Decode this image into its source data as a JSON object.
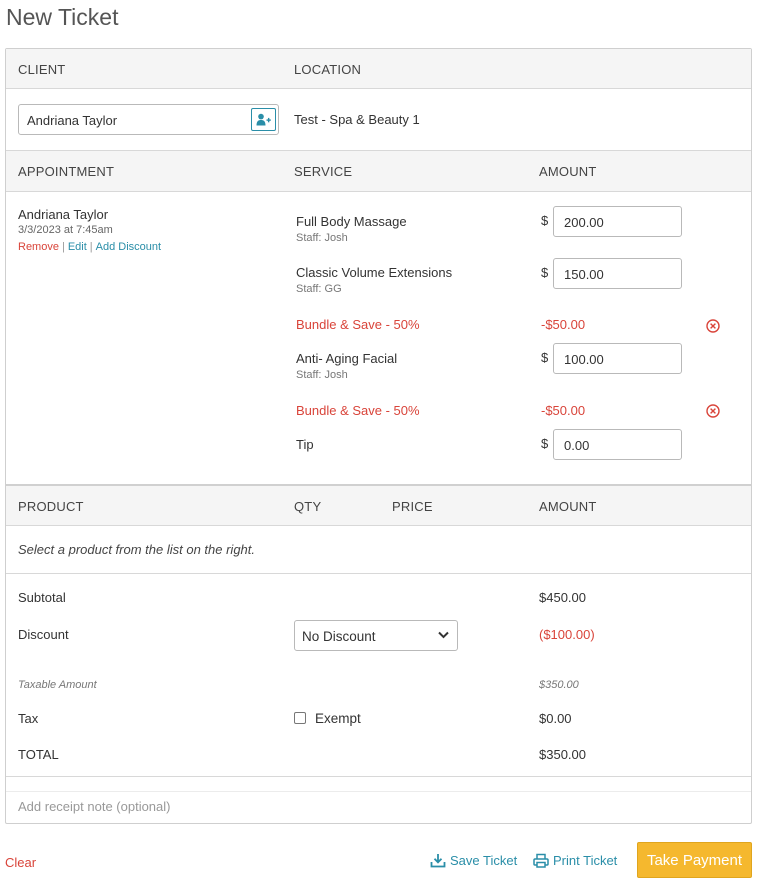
{
  "page": {
    "title": "New Ticket"
  },
  "client_section": {
    "client_header": "CLIENT",
    "location_header": "LOCATION",
    "client_value": "Andriana Taylor",
    "location_value": "Test - Spa & Beauty 1"
  },
  "appointment_section": {
    "appointment_header": "APPOINTMENT",
    "service_header": "SERVICE",
    "amount_header": "AMOUNT",
    "client_name": "Andriana Taylor",
    "datetime": "3/3/2023 at 7:45am",
    "actions": {
      "remove": "Remove",
      "edit": "Edit",
      "add_discount": "Add Discount",
      "separator": "|"
    },
    "currency": "$",
    "services": [
      {
        "name": "Full Body Massage",
        "staff": "Staff: Josh",
        "amount": "200.00"
      },
      {
        "name": "Classic Volume Extensions",
        "staff": "Staff: GG",
        "amount": "150.00"
      },
      {
        "name": "Anti- Aging Facial",
        "staff": "Staff: Josh",
        "amount": "100.00"
      }
    ],
    "discounts": [
      {
        "name": "Bundle & Save - 50%",
        "amount": "-$50.00"
      },
      {
        "name": "Bundle & Save - 50%",
        "amount": "-$50.00"
      }
    ],
    "tip": {
      "label": "Tip",
      "amount": "0.00"
    }
  },
  "product_section": {
    "product_header": "PRODUCT",
    "qty_header": "QTY",
    "price_header": "PRICE",
    "amount_header": "AMOUNT",
    "empty_message": "Select a product from the list on the right."
  },
  "totals": {
    "subtotal_label": "Subtotal",
    "subtotal_value": "$450.00",
    "discount_label": "Discount",
    "discount_select": "No Discount",
    "discount_value": "($100.00)",
    "taxable_label": "Taxable Amount",
    "taxable_value": "$350.00",
    "tax_label": "Tax",
    "exempt_label": "Exempt",
    "tax_value": "$0.00",
    "total_label": "TOTAL",
    "total_value": "$350.00"
  },
  "receipt_note": {
    "placeholder": "Add receipt note (optional)"
  },
  "footer": {
    "clear": "Clear",
    "save_ticket": "Save Ticket",
    "print_ticket": "Print Ticket",
    "take_payment": "Take Payment"
  },
  "colors": {
    "accent": "#2a8ea8",
    "danger": "#d9443a",
    "primary_button": "#f5b82e"
  },
  "icons": [
    "add-client-icon",
    "remove-discount-icon",
    "chevron-down-icon",
    "download-icon",
    "print-icon"
  ]
}
